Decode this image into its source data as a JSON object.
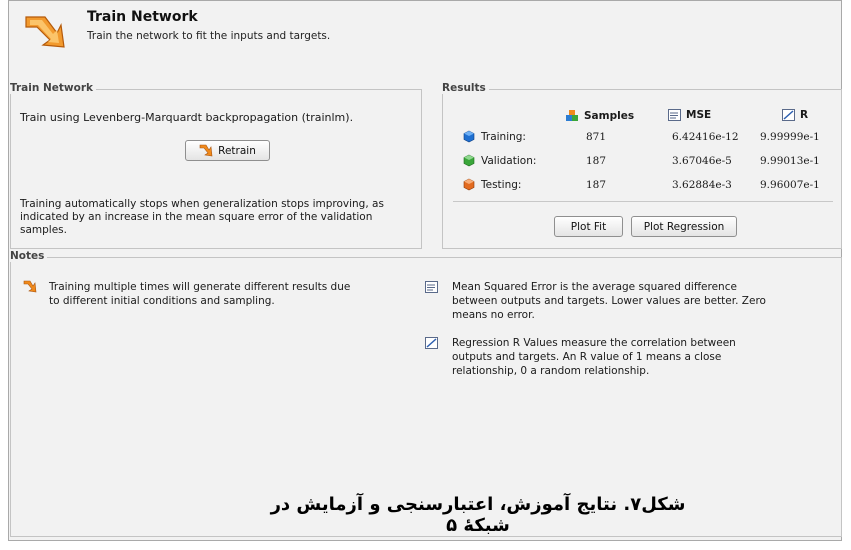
{
  "header": {
    "title": "Train Network",
    "subtitle": "Train the network to fit the inputs and targets."
  },
  "train_network": {
    "group_label": "Train Network",
    "description": "Train using Levenberg-Marquardt backpropagation (trainlm).",
    "retrain_label": "Retrain",
    "stop_text_line1": "Training automatically stops when generalization stops improving, as",
    "stop_text_line2": "indicated by an increase in the mean square error of the validation",
    "stop_text_line3": "samples."
  },
  "results": {
    "group_label": "Results",
    "columns": [
      "Samples",
      "MSE",
      "R"
    ],
    "rows": [
      {
        "label": "Training:",
        "samples": "871",
        "mse": "6.42416e-12",
        "r": "9.99999e-1",
        "color": "#1f6fd0"
      },
      {
        "label": "Validation:",
        "samples": "187",
        "mse": "3.67046e-5",
        "r": "9.99013e-1",
        "color": "#3aa63a"
      },
      {
        "label": "Testing:",
        "samples": "187",
        "mse": "3.62884e-3",
        "r": "9.96007e-1",
        "color": "#e36b1f"
      }
    ],
    "plot_fit_label": "Plot Fit",
    "plot_regression_label": "Plot Regression"
  },
  "notes": {
    "group_label": "Notes",
    "note1_line1": "Training multiple times will generate different results due",
    "note1_line2": "to different initial conditions and sampling.",
    "note2_line1": "Mean Squared Error is the average squared difference",
    "note2_line2": "between outputs and targets. Lower values are better. Zero",
    "note2_line3": "means no error.",
    "note3_line1": "Regression R Values measure the correlation between",
    "note3_line2": "outputs and targets. An R value of 1 means a close",
    "note3_line3": "relationship, 0 a random relationship."
  },
  "caption": "شکل۷. نتایج آموزش، اعتبارسنجی و آزمایش در شبکهٔ ۵",
  "colors": {
    "accent_orange": "#f08a1c",
    "panel_bg": "#f2f2f2"
  }
}
